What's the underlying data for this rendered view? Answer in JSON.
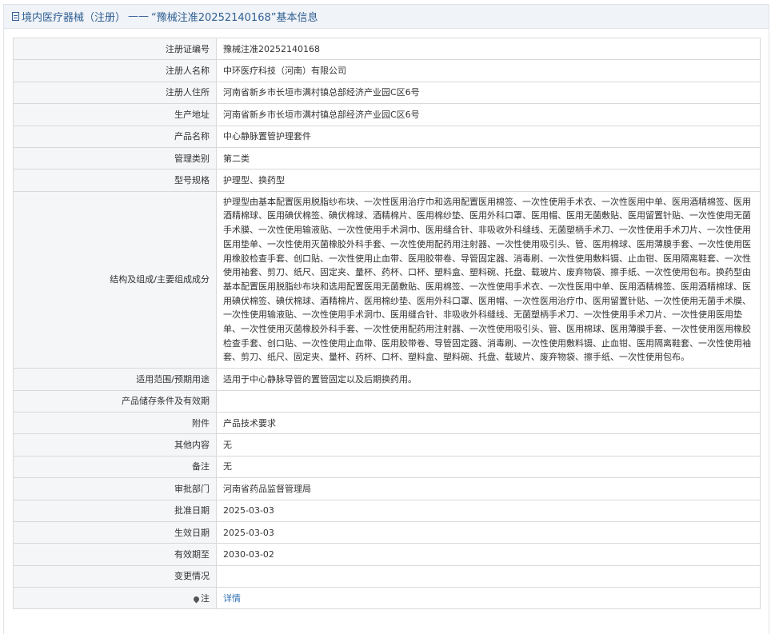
{
  "title": {
    "category": "境内医疗器械（注册）",
    "separator": "——",
    "subject": "“豫械注准20252140168”基本信息"
  },
  "rows": [
    {
      "label": "注册证编号",
      "value": "豫械注准20252140168"
    },
    {
      "label": "注册人名称",
      "value": "中环医疗科技（河南）有限公司"
    },
    {
      "label": "注册人住所",
      "value": "河南省新乡市长垣市满村镇总部经济产业园C区6号"
    },
    {
      "label": "生产地址",
      "value": "河南省新乡市长垣市满村镇总部经济产业园C区6号"
    },
    {
      "label": "产品名称",
      "value": "中心静脉置管护理套件"
    },
    {
      "label": "管理类别",
      "value": "第二类"
    },
    {
      "label": "型号规格",
      "value": "护理型、换药型"
    },
    {
      "label": "结构及组成/主要组成成分",
      "value": "护理型由基本配置医用脱脂纱布块、一次性医用治疗巾和选用配置医用棉签、一次性使用手术衣、一次性医用中单、医用酒精棉签、医用酒精棉球、医用碘伏棉签、碘伏棉球、酒精棉片、医用棉纱垫、医用外科口罩、医用帽、医用无菌敷贴、医用留置针贴、一次性使用无菌手术膜、一次性使用输液贴、一次性使用手术洞巾、医用缝合针、非吸收外科缝线、无菌塑柄手术刀、一次性使用手术刀片、一次性使用医用垫单、一次性使用灭菌橡胶外科手套、一次性使用配药用注射器、一次性使用吸引头、管、医用棉球、医用薄膜手套、一次性使用医用橡胶检查手套、创口贴、一次性使用止血带、医用胶带卷、导管固定器、消毒刷、一次性使用敷料镊、止血钳、医用隔离鞋套、一次性使用袖套、剪刀、纸尺、固定夹、量杯、药杯、口杯、塑料盒、塑料碗、托盘、载玻片、废弃物袋、擦手纸、一次性使用包布。换药型由基本配置医用脱脂纱布块和选用配置医用无菌敷贴、医用棉签、一次性使用手术衣、一次性医用中单、医用酒精棉签、医用酒精棉球、医用碘伏棉签、碘伏棉球、酒精棉片、医用棉纱垫、医用外科口罩、医用帽、一次性医用治疗巾、医用留置针贴、一次性使用无菌手术膜、一次性使用输液贴、一次性使用手术洞巾、医用缝合针、非吸收外科缝线、无菌塑柄手术刀、一次性使用手术刀片、一次性使用医用垫单、一次性使用灭菌橡胶外科手套、一次性使用配药用注射器、一次性使用吸引头、管、医用棉球、医用薄膜手套、一次性使用医用橡胶检查手套、创口贴、一次性使用止血带、医用胶带卷、导管固定器、消毒刷、一次性使用敷料镊、止血钳、医用隔离鞋套、一次性使用袖套、剪刀、纸尺、固定夹、量杯、药杯、口杯、塑料盒、塑料碗、托盘、载玻片、废弃物袋、擦手纸、一次性使用包布。"
    },
    {
      "label": "适用范围/预期用途",
      "value": "适用于中心静脉导管的置管固定以及后期换药用。"
    },
    {
      "label": "产品储存条件及有效期",
      "value": ""
    },
    {
      "label": "附件",
      "value": "产品技术要求"
    },
    {
      "label": "其他内容",
      "value": "无"
    },
    {
      "label": "备注",
      "value": "无"
    },
    {
      "label": "审批部门",
      "value": "河南省药品监督管理局"
    },
    {
      "label": "批准日期",
      "value": "2025-03-03"
    },
    {
      "label": "生效日期",
      "value": "2025-03-03"
    },
    {
      "label": "有效期至",
      "value": "2030-03-02"
    },
    {
      "label": "变更情况",
      "value": ""
    }
  ],
  "note_row": {
    "label": "注",
    "icon": "pin-icon",
    "link_text": "详情"
  }
}
